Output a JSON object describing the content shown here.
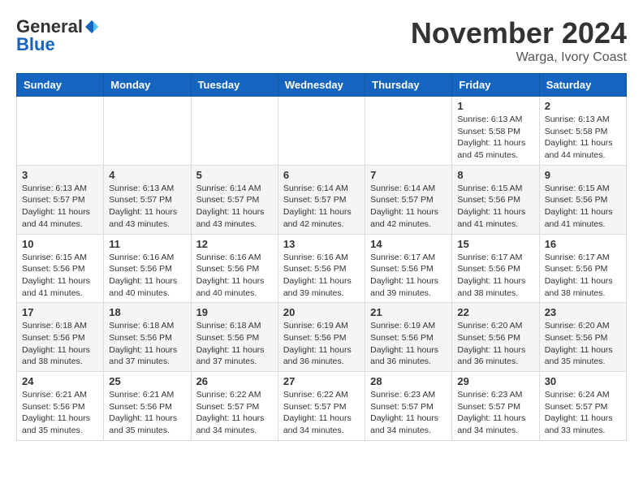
{
  "header": {
    "logo_general": "General",
    "logo_blue": "Blue",
    "month_title": "November 2024",
    "location": "Warga, Ivory Coast"
  },
  "days_of_week": [
    "Sunday",
    "Monday",
    "Tuesday",
    "Wednesday",
    "Thursday",
    "Friday",
    "Saturday"
  ],
  "weeks": [
    [
      {
        "day": "",
        "info": ""
      },
      {
        "day": "",
        "info": ""
      },
      {
        "day": "",
        "info": ""
      },
      {
        "day": "",
        "info": ""
      },
      {
        "day": "",
        "info": ""
      },
      {
        "day": "1",
        "info": "Sunrise: 6:13 AM\nSunset: 5:58 PM\nDaylight: 11 hours and 45 minutes."
      },
      {
        "day": "2",
        "info": "Sunrise: 6:13 AM\nSunset: 5:58 PM\nDaylight: 11 hours and 44 minutes."
      }
    ],
    [
      {
        "day": "3",
        "info": "Sunrise: 6:13 AM\nSunset: 5:57 PM\nDaylight: 11 hours and 44 minutes."
      },
      {
        "day": "4",
        "info": "Sunrise: 6:13 AM\nSunset: 5:57 PM\nDaylight: 11 hours and 43 minutes."
      },
      {
        "day": "5",
        "info": "Sunrise: 6:14 AM\nSunset: 5:57 PM\nDaylight: 11 hours and 43 minutes."
      },
      {
        "day": "6",
        "info": "Sunrise: 6:14 AM\nSunset: 5:57 PM\nDaylight: 11 hours and 42 minutes."
      },
      {
        "day": "7",
        "info": "Sunrise: 6:14 AM\nSunset: 5:57 PM\nDaylight: 11 hours and 42 minutes."
      },
      {
        "day": "8",
        "info": "Sunrise: 6:15 AM\nSunset: 5:56 PM\nDaylight: 11 hours and 41 minutes."
      },
      {
        "day": "9",
        "info": "Sunrise: 6:15 AM\nSunset: 5:56 PM\nDaylight: 11 hours and 41 minutes."
      }
    ],
    [
      {
        "day": "10",
        "info": "Sunrise: 6:15 AM\nSunset: 5:56 PM\nDaylight: 11 hours and 41 minutes."
      },
      {
        "day": "11",
        "info": "Sunrise: 6:16 AM\nSunset: 5:56 PM\nDaylight: 11 hours and 40 minutes."
      },
      {
        "day": "12",
        "info": "Sunrise: 6:16 AM\nSunset: 5:56 PM\nDaylight: 11 hours and 40 minutes."
      },
      {
        "day": "13",
        "info": "Sunrise: 6:16 AM\nSunset: 5:56 PM\nDaylight: 11 hours and 39 minutes."
      },
      {
        "day": "14",
        "info": "Sunrise: 6:17 AM\nSunset: 5:56 PM\nDaylight: 11 hours and 39 minutes."
      },
      {
        "day": "15",
        "info": "Sunrise: 6:17 AM\nSunset: 5:56 PM\nDaylight: 11 hours and 38 minutes."
      },
      {
        "day": "16",
        "info": "Sunrise: 6:17 AM\nSunset: 5:56 PM\nDaylight: 11 hours and 38 minutes."
      }
    ],
    [
      {
        "day": "17",
        "info": "Sunrise: 6:18 AM\nSunset: 5:56 PM\nDaylight: 11 hours and 38 minutes."
      },
      {
        "day": "18",
        "info": "Sunrise: 6:18 AM\nSunset: 5:56 PM\nDaylight: 11 hours and 37 minutes."
      },
      {
        "day": "19",
        "info": "Sunrise: 6:18 AM\nSunset: 5:56 PM\nDaylight: 11 hours and 37 minutes."
      },
      {
        "day": "20",
        "info": "Sunrise: 6:19 AM\nSunset: 5:56 PM\nDaylight: 11 hours and 36 minutes."
      },
      {
        "day": "21",
        "info": "Sunrise: 6:19 AM\nSunset: 5:56 PM\nDaylight: 11 hours and 36 minutes."
      },
      {
        "day": "22",
        "info": "Sunrise: 6:20 AM\nSunset: 5:56 PM\nDaylight: 11 hours and 36 minutes."
      },
      {
        "day": "23",
        "info": "Sunrise: 6:20 AM\nSunset: 5:56 PM\nDaylight: 11 hours and 35 minutes."
      }
    ],
    [
      {
        "day": "24",
        "info": "Sunrise: 6:21 AM\nSunset: 5:56 PM\nDaylight: 11 hours and 35 minutes."
      },
      {
        "day": "25",
        "info": "Sunrise: 6:21 AM\nSunset: 5:56 PM\nDaylight: 11 hours and 35 minutes."
      },
      {
        "day": "26",
        "info": "Sunrise: 6:22 AM\nSunset: 5:57 PM\nDaylight: 11 hours and 34 minutes."
      },
      {
        "day": "27",
        "info": "Sunrise: 6:22 AM\nSunset: 5:57 PM\nDaylight: 11 hours and 34 minutes."
      },
      {
        "day": "28",
        "info": "Sunrise: 6:23 AM\nSunset: 5:57 PM\nDaylight: 11 hours and 34 minutes."
      },
      {
        "day": "29",
        "info": "Sunrise: 6:23 AM\nSunset: 5:57 PM\nDaylight: 11 hours and 34 minutes."
      },
      {
        "day": "30",
        "info": "Sunrise: 6:24 AM\nSunset: 5:57 PM\nDaylight: 11 hours and 33 minutes."
      }
    ]
  ]
}
